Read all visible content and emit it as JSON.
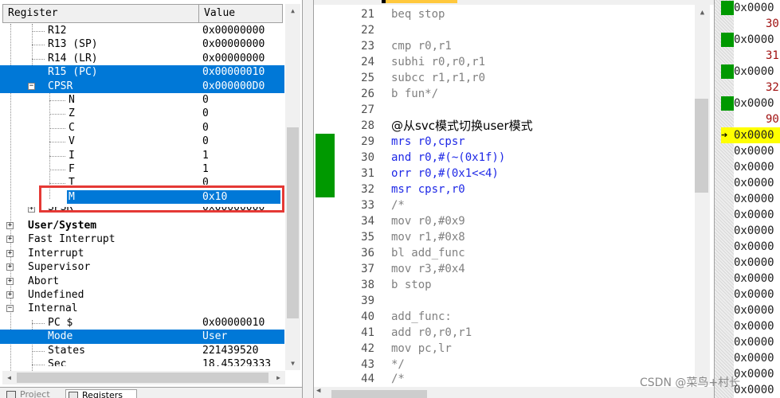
{
  "registers_panel": {
    "columns": {
      "register": "Register",
      "value": "Value"
    },
    "rows": [
      {
        "name": "R12",
        "value": "0x00000000"
      },
      {
        "name": "R13 (SP)",
        "value": "0x00000000"
      },
      {
        "name": "R14 (LR)",
        "value": "0x00000000"
      },
      {
        "name": "R15 (PC)",
        "value": "0x00000010",
        "selected": true
      },
      {
        "name": "CPSR",
        "value": "0x000000D0",
        "selected": true
      },
      {
        "name": "N",
        "value": "0"
      },
      {
        "name": "Z",
        "value": "0"
      },
      {
        "name": "C",
        "value": "0"
      },
      {
        "name": "V",
        "value": "0"
      },
      {
        "name": "I",
        "value": "1"
      },
      {
        "name": "F",
        "value": "1"
      },
      {
        "name": "T",
        "value": "0"
      },
      {
        "name": "M",
        "value": "0x10",
        "selected": true
      },
      {
        "name": "SPSR",
        "value": "0x00000000"
      },
      {
        "name": "User/System",
        "value": ""
      },
      {
        "name": "Fast Interrupt",
        "value": ""
      },
      {
        "name": "Interrupt",
        "value": ""
      },
      {
        "name": "Supervisor",
        "value": ""
      },
      {
        "name": "Abort",
        "value": ""
      },
      {
        "name": "Undefined",
        "value": ""
      },
      {
        "name": "Internal",
        "value": ""
      },
      {
        "name": "PC  $",
        "value": "0x00000010"
      },
      {
        "name": "Mode",
        "value": "User",
        "selected": true
      },
      {
        "name": "States",
        "value": "221439520"
      },
      {
        "name": "Sec",
        "value": "18.45329333"
      }
    ],
    "bottom_tabs": [
      "Project",
      "Registers"
    ]
  },
  "editor": {
    "lines": [
      {
        "n": "21",
        "text": "beq stop"
      },
      {
        "n": "22",
        "text": ""
      },
      {
        "n": "23",
        "text": "cmp r0,r1"
      },
      {
        "n": "24",
        "text": "subhi r0,r0,r1"
      },
      {
        "n": "25",
        "text": "subcc r1,r1,r0"
      },
      {
        "n": "26",
        "text": "b fun*/"
      },
      {
        "n": "27",
        "text": ""
      },
      {
        "n": "28",
        "text": "@从svc模式切换user模式"
      },
      {
        "n": "29",
        "text": "mrs r0,cpsr"
      },
      {
        "n": "30",
        "text": "and r0,#(~(0x1f))"
      },
      {
        "n": "31",
        "text": "orr r0,#(0x1<<4)"
      },
      {
        "n": "32",
        "text": "msr cpsr,r0"
      },
      {
        "n": "33",
        "text": "/*"
      },
      {
        "n": "34",
        "text": "mov r0,#0x9"
      },
      {
        "n": "35",
        "text": "mov r1,#0x8"
      },
      {
        "n": "36",
        "text": "bl add_func"
      },
      {
        "n": "37",
        "text": "mov r3,#0x4"
      },
      {
        "n": "38",
        "text": "b stop"
      },
      {
        "n": "39",
        "text": ""
      },
      {
        "n": "40",
        "text": "add_func:"
      },
      {
        "n": "41",
        "text": "add r0,r0,r1"
      },
      {
        "n": "42",
        "text": "mov pc,lr"
      },
      {
        "n": "43",
        "text": "*/"
      },
      {
        "n": "44",
        "text": "/*"
      }
    ]
  },
  "disassembly": {
    "rows": [
      {
        "addr": "0x0000",
        "sub": ""
      },
      {
        "addr": "",
        "sub": "30"
      },
      {
        "addr": "0x0000",
        "sub": ""
      },
      {
        "addr": "",
        "sub": "31"
      },
      {
        "addr": "0x0000",
        "sub": ""
      },
      {
        "addr": "",
        "sub": "32"
      },
      {
        "addr": "0x0000",
        "sub": ""
      },
      {
        "addr": "",
        "sub": "90"
      },
      {
        "addr": "0x0000",
        "sub": "",
        "current": true
      },
      {
        "addr": "0x0000",
        "sub": ""
      },
      {
        "addr": "0x0000",
        "sub": ""
      },
      {
        "addr": "0x0000",
        "sub": ""
      },
      {
        "addr": "0x0000",
        "sub": ""
      },
      {
        "addr": "0x0000",
        "sub": ""
      },
      {
        "addr": "0x0000",
        "sub": ""
      },
      {
        "addr": "0x0000",
        "sub": ""
      },
      {
        "addr": "0x0000",
        "sub": ""
      },
      {
        "addr": "0x0000",
        "sub": ""
      },
      {
        "addr": "0x0000",
        "sub": ""
      },
      {
        "addr": "0x0000",
        "sub": ""
      },
      {
        "addr": "0x0000",
        "sub": ""
      },
      {
        "addr": "0x0000",
        "sub": ""
      },
      {
        "addr": "0x0000",
        "sub": ""
      },
      {
        "addr": "0x0000",
        "sub": ""
      },
      {
        "addr": "0x0000",
        "sub": ""
      }
    ]
  },
  "watermark": "CSDN @菜鸟+村长",
  "colors": {
    "selection": "#0078d7",
    "exec_marker": "#009900",
    "current_line": "#ffff00",
    "highlight_box": "#e53935"
  }
}
